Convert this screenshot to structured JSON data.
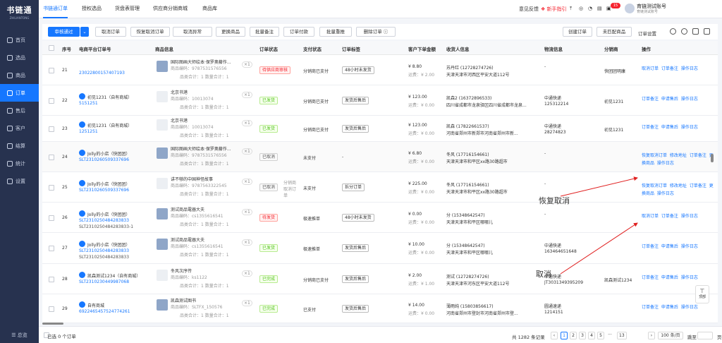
{
  "sidebar": {
    "logo": "书链通",
    "logo_en": "ZHILIANTONG",
    "items": [
      {
        "label": "首页"
      },
      {
        "label": "选品"
      },
      {
        "label": "商品"
      },
      {
        "label": "订单"
      },
      {
        "label": "售后"
      },
      {
        "label": "客户"
      },
      {
        "label": "结算"
      },
      {
        "label": "统计"
      },
      {
        "label": "设置"
      }
    ],
    "bottom": "☰ 总览"
  },
  "topbar": {
    "tabs": [
      "书链通订单",
      "授权选品",
      "货盘表管理",
      "供应商分销商城",
      "商品库"
    ],
    "right": {
      "feedback": "意见反馈",
      "guide": "新手指引",
      "badge": "15",
      "user_name": "育链测试账号",
      "user_sub": "育链测试账号"
    }
  },
  "toolbar": {
    "review_pass": "审核通过",
    "buttons": [
      "取消订单",
      "恢复取消订单",
      "取消异常",
      "更换商品",
      "批量备注",
      "订单付款",
      "批量重推",
      "删除订单 ⓘ"
    ],
    "right_buttons": [
      "创建订单",
      "未匹配商品",
      "订单设置"
    ]
  },
  "table": {
    "headers": [
      "序号",
      "电商平台订单号",
      "商品信息",
      "订单状态",
      "支付状态",
      "订单标签",
      "客户下单金额",
      "收货人信息",
      "物流信息",
      "分销商",
      "操作"
    ],
    "rows": [
      {
        "no": "21",
        "store": "",
        "order": "23022800157407193",
        "goods": "国际图画大师绘本·保罗奥藤作...",
        "code": "商品编码：9787531576556",
        "sum": "品类合计：1  数量合计：1",
        "status": "待供应商审核",
        "status_kind": "red",
        "pay": "分销商已支付",
        "label": "48小时未发货",
        "amount": "¥ 8.80",
        "freight": "运费：¥ 2.00",
        "recv": "苏丹红 (12728274726)",
        "addr": "天津天津市河西区平安大道112号",
        "logi": "-",
        "logi_no": "",
        "dist": "快团团明康",
        "ops": "取消订单 订单备注 操作日志",
        "thumb": "real"
      },
      {
        "no": "22",
        "store": "初见1231（自有商城）",
        "order": "5151251",
        "goods": "北京书港",
        "code": "商品编码：10013074",
        "sum": "品类合计：1  数量合计：1",
        "status": "已发货",
        "status_kind": "green",
        "pay": "分销商已支付",
        "label": "发货后售后",
        "amount": "¥ 123.00",
        "freight": "运费：¥ 0.00",
        "recv": "凯森2 (16372896533)",
        "addr": "四川省成都市龙泉驿区四川省成都市龙泉...",
        "logi": "中通快递",
        "logi_no": "125312214",
        "dist": "初见1231",
        "ops": "订单备注 申请售后 操作日志",
        "thumb": "ph"
      },
      {
        "no": "23",
        "store": "初见1231（自有商城）",
        "order": "1251251",
        "goods": "北京书港",
        "code": "商品编码：10013074",
        "sum": "品类合计：1  数量合计：1",
        "status": "已发货",
        "status_kind": "green",
        "pay": "分销商已支付",
        "label": "发货后售后",
        "amount": "¥ 123.00",
        "freight": "运费：¥ 0.00",
        "recv": "凯森 (17822661537)",
        "addr": "河南省郑州市新郑市河南省郑州市新...",
        "logi": "中通快递",
        "logi_no": "28274823",
        "dist": "初见1231",
        "ops": "订单备注 申请售后 操作日志",
        "thumb": "ph"
      },
      {
        "no": "24",
        "store": "Jolly的小店（快团团）",
        "order": "SLT2310260509337696",
        "goods": "国际图画大师绘本·保罗奥藤作...",
        "code": "商品编码：9787531576556",
        "sum": "品类合计：1  数量合计：1",
        "status": "已取消",
        "status_kind": "gray",
        "pay": "未支付",
        "label": "-",
        "amount": "¥ 6.80",
        "freight": "运费：¥ 0.00",
        "recv": "冬风 (17716154661)",
        "addr": "天津天津市和平区xx路30路超市",
        "logi": "-",
        "logi_no": "",
        "dist": "",
        "ops": "恢复取消订单 修改地址 订单备注 更换商品 操作日志",
        "thumb": "real"
      },
      {
        "no": "25",
        "store": "Jolly的小店（快团团）",
        "order": "SLT2310260509337696",
        "goods": "讲不够的中国神怪故事",
        "code": "商品编码：9787563322545",
        "sum": "品类合计：1  数量合计：1",
        "status": "已取消",
        "status_kind": "gray",
        "pay": "未支付",
        "label": "拆分订单",
        "amount": "¥ 225.00",
        "freight": "运费：¥ 0.00",
        "recv": "冬风 (17716154661)",
        "addr": "天津天津市和平区xx路30路超市",
        "logi": "-",
        "logi_no": "",
        "dist": "",
        "ops": "恢复取消订单 修改地址 订单备注 更换商品 操作日志",
        "thumb": "ph",
        "sub": "分销商取消订单"
      },
      {
        "no": "26",
        "store": "Jolly的小店（快团团）",
        "order": "SLT2310250484283833",
        "order2": "SLT2310250484283833-1",
        "goods": "测试商品電器大夫",
        "code": "商品编码：cs1355616541",
        "sum": "品类合计：1  数量合计：1",
        "status": "待发货",
        "status_kind": "red",
        "pay": "极速推单",
        "label": "48小时未发货",
        "amount": "¥ 0.00",
        "freight": "运费：¥ 0.00",
        "recv": "分 (15348642547)",
        "addr": "天津天津市和平区哪哪儿",
        "logi": "-",
        "logi_no": "",
        "dist": "",
        "ops": "取消订单 订单备注 操作日志",
        "thumb": "real"
      },
      {
        "no": "27",
        "store": "Jolly的小店（快团团）",
        "order": "SLT2310250484283833",
        "order2": "SLT2310250484283833",
        "goods": "测试商品電器大夫",
        "code": "商品编码：cs1355616541",
        "sum": "品类合计：1  数量合计：1",
        "status": "已发货",
        "status_kind": "green",
        "pay": "极速推单",
        "label": "发货后售后",
        "amount": "¥ 10.00",
        "freight": "运费：¥ 0.00",
        "recv": "分 (15348642547)",
        "addr": "天津天津市和平区哪哪儿",
        "logi": "中通快递",
        "logi_no": "163464651648",
        "dist": "",
        "ops": "订单备注 申请售后 操作日志",
        "thumb": "real"
      },
      {
        "no": "28",
        "store": "凯森测试1234（自有商城）",
        "order": "SLT2310230449987068",
        "goods": "冬风次序传",
        "code": "商品编码：ks1122",
        "sum": "品类合计：1  数量合计：1",
        "status": "已完成",
        "status_kind": "green",
        "pay": "分销商已支付",
        "label": "发货后售后",
        "amount": "¥ 2.00",
        "freight": "运费：¥ 1.00",
        "recv": "测试 (12728274726)",
        "addr": "天津天津市河东区平安大道112号",
        "logi": "中通快递",
        "logi_no": "JT3031349395209",
        "dist": "凯森测试1234",
        "ops": "订单备注 申请售后 操作日志",
        "thumb": "ph"
      },
      {
        "no": "29",
        "store": "自有商城",
        "order": "6922465457524774261",
        "goods": "凯森测试图书",
        "code": "商品编码：SLTFX_150576",
        "sum": "品类合计：1  数量合计：1",
        "status": "已完成",
        "status_kind": "green",
        "pay": "已支付",
        "label": "发货后售后",
        "amount": "¥ 14.00",
        "freight": "运费：¥ 0.00",
        "recv": "薄雨纯 (15803856617)",
        "addr": "河南省郑州市登封市河南省郑州市登...",
        "logi": "圆通速递",
        "logi_no": "1214151",
        "dist": "",
        "ops": "订单备注 申请售后 操作日志",
        "thumb": "real"
      }
    ]
  },
  "annotations": {
    "restore": "恢复取消",
    "cancel": "取消"
  },
  "footer": {
    "selected": "已选 0 个订单",
    "total": "共 1282 条记录",
    "pages": [
      "1",
      "2",
      "3",
      "4",
      "5",
      "···",
      "13"
    ],
    "page_size": "100 条/页",
    "jump": "跳至",
    "page_unit": "页"
  },
  "top_button": "顶部",
  "colors": {
    "accent": "#1677ff",
    "sidebar": "#27324f"
  }
}
